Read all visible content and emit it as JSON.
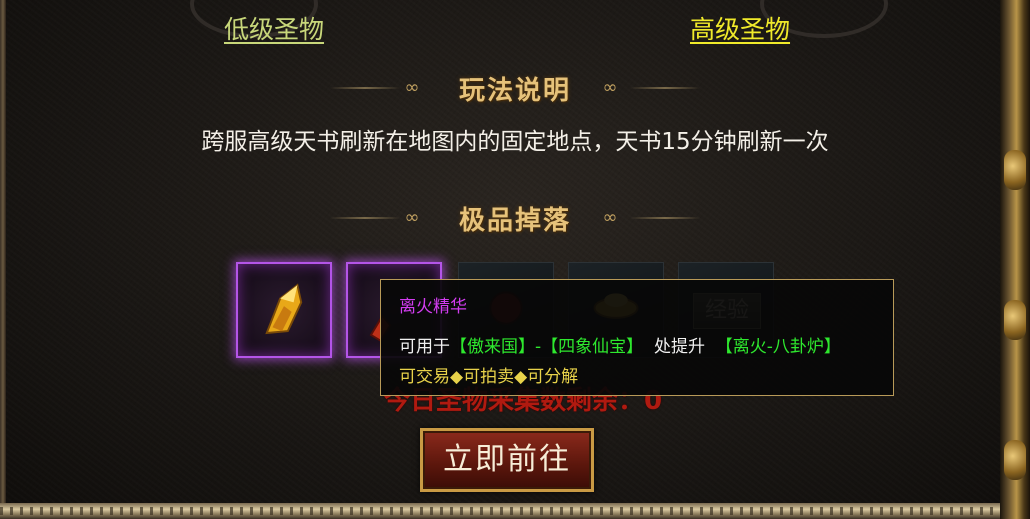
{
  "tabs": {
    "low_relic": "低级圣物",
    "high_relic": "高级圣物"
  },
  "rules": {
    "header": "玩法说明",
    "text": "跨服高级天书刷新在地图内的固定地点，天书15分钟刷新一次"
  },
  "drops": {
    "header": "极品掉落",
    "items": [
      {
        "icon": "golden-crystal-icon",
        "rarity": "epic"
      },
      {
        "icon": "red-crystal-icon",
        "rarity": "epic"
      },
      {
        "icon": "red-orb-icon",
        "rarity": "normal"
      },
      {
        "icon": "gold-ingot-icon",
        "rarity": "normal"
      },
      {
        "icon": "exp-scroll-icon",
        "rarity": "normal",
        "label": "经验"
      }
    ]
  },
  "remaining": "今日圣物采集数剩余：0",
  "tooltip": {
    "name": "离火精华",
    "use_prefix": "可用于",
    "location": "【傲来国】-【四象仙宝】",
    "upgrade_prefix": "处提升",
    "target": "【离火-八卦炉】",
    "trade": "可交易◆可拍卖◆可分解"
  },
  "go_button": "立即前往",
  "colors": {
    "epic_border": "#b455e8",
    "tooltip_name": "#d23cf0",
    "tooltip_green": "#2ee82e",
    "tooltip_yellow": "#e8d24a",
    "remaining_red": "#b01a10",
    "header_gold": "#e6c27a"
  }
}
